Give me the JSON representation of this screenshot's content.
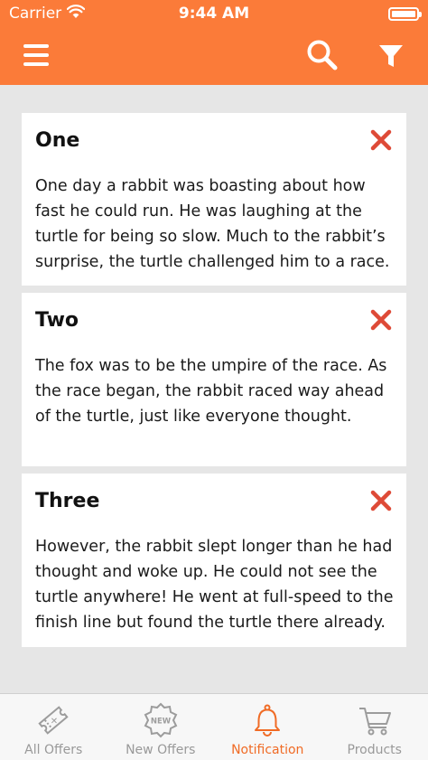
{
  "status_bar": {
    "carrier": "Carrier",
    "time": "9:44 AM",
    "battery_level": 1.0
  },
  "header": {
    "menu_icon": "hamburger-menu-icon",
    "search_icon": "magnifier-search-icon",
    "filter_icon": "funnel-filter-icon",
    "accent_color": "#fb7b39"
  },
  "notifications": [
    {
      "title": "One",
      "body": "One day a rabbit was boasting about how fast he could run. He was laughing at the turtle for being so slow. Much to the rabbit’s surprise, the turtle challenged him to a race.",
      "close_icon": "close-x-icon"
    },
    {
      "title": "Two",
      "body": "The fox was to be the umpire of the race. As the race began, the rabbit raced way ahead of the turtle, just like everyone thought.",
      "close_icon": "close-x-icon"
    },
    {
      "title": "Three",
      "body": "However, the rabbit slept longer than he had thought and woke up. He could not see the turtle anywhere! He went at full-speed to the finish line but found the turtle there already.",
      "close_icon": "close-x-icon"
    }
  ],
  "tabbar": {
    "active_color": "#f06b25",
    "inactive_color": "#999999",
    "tabs": [
      {
        "label": "All Offers",
        "icon": "ticket-icon",
        "active": false
      },
      {
        "label": "New Offers",
        "icon": "new-badge-icon",
        "badge_text": "NEW",
        "active": false
      },
      {
        "label": "Notification",
        "icon": "bell-icon",
        "active": true
      },
      {
        "label": "Products",
        "icon": "cart-icon",
        "active": false
      }
    ]
  }
}
